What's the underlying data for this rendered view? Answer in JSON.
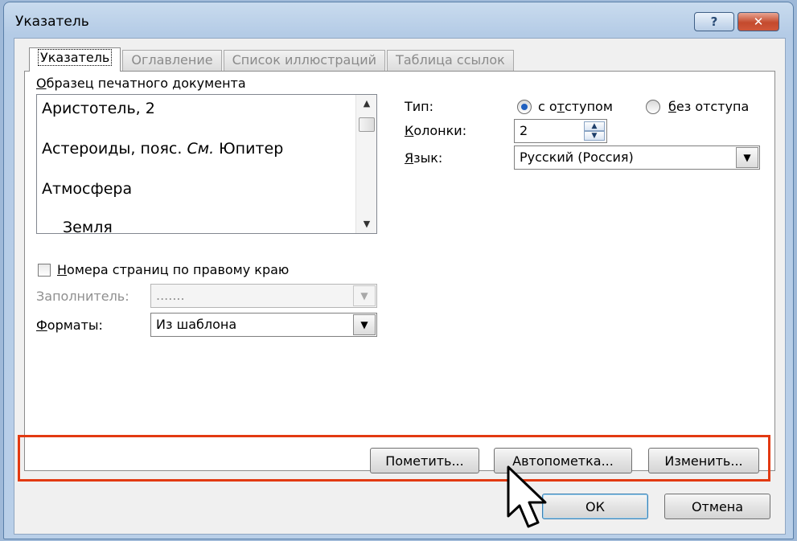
{
  "window": {
    "title": "Указатель",
    "help": "?",
    "close": "✕"
  },
  "tabs": [
    {
      "label": "Указатель"
    },
    {
      "label": "Оглавление"
    },
    {
      "label": "Список иллюстраций"
    },
    {
      "label": "Таблица ссылок"
    }
  ],
  "preview": {
    "label": "Образец печатного документа",
    "lines": [
      {
        "main": "Аристотель, 2",
        "italic": "",
        "rest": ""
      },
      {
        "main": "Астероиды, пояс. ",
        "italic": "См.",
        "rest": " Юпитер"
      },
      {
        "main": "Атмосфера",
        "italic": "",
        "rest": ""
      },
      {
        "main": "Земля",
        "italic": "",
        "rest": ""
      }
    ]
  },
  "right_align": {
    "label": "Номера страниц по правому краю",
    "checked": false
  },
  "leader": {
    "label": "Заполнитель:",
    "value": "......."
  },
  "formats": {
    "label": "Форматы:",
    "value": "Из шаблона"
  },
  "type": {
    "label": "Тип:",
    "option_indent": "с отступом",
    "option_noindent": "без отступа",
    "selected": "с отступом"
  },
  "columns": {
    "label": "Колонки:",
    "value": "2"
  },
  "language": {
    "label": "Язык:",
    "value": "Русский (Россия)"
  },
  "buttons": {
    "mark": "Пометить...",
    "automark": "Автопометка...",
    "modify": "Изменить...",
    "ok": "ОК",
    "cancel": "Отмена"
  },
  "colors": {
    "highlight": "#e23a12",
    "radio_dot": "#1f5fbf"
  }
}
